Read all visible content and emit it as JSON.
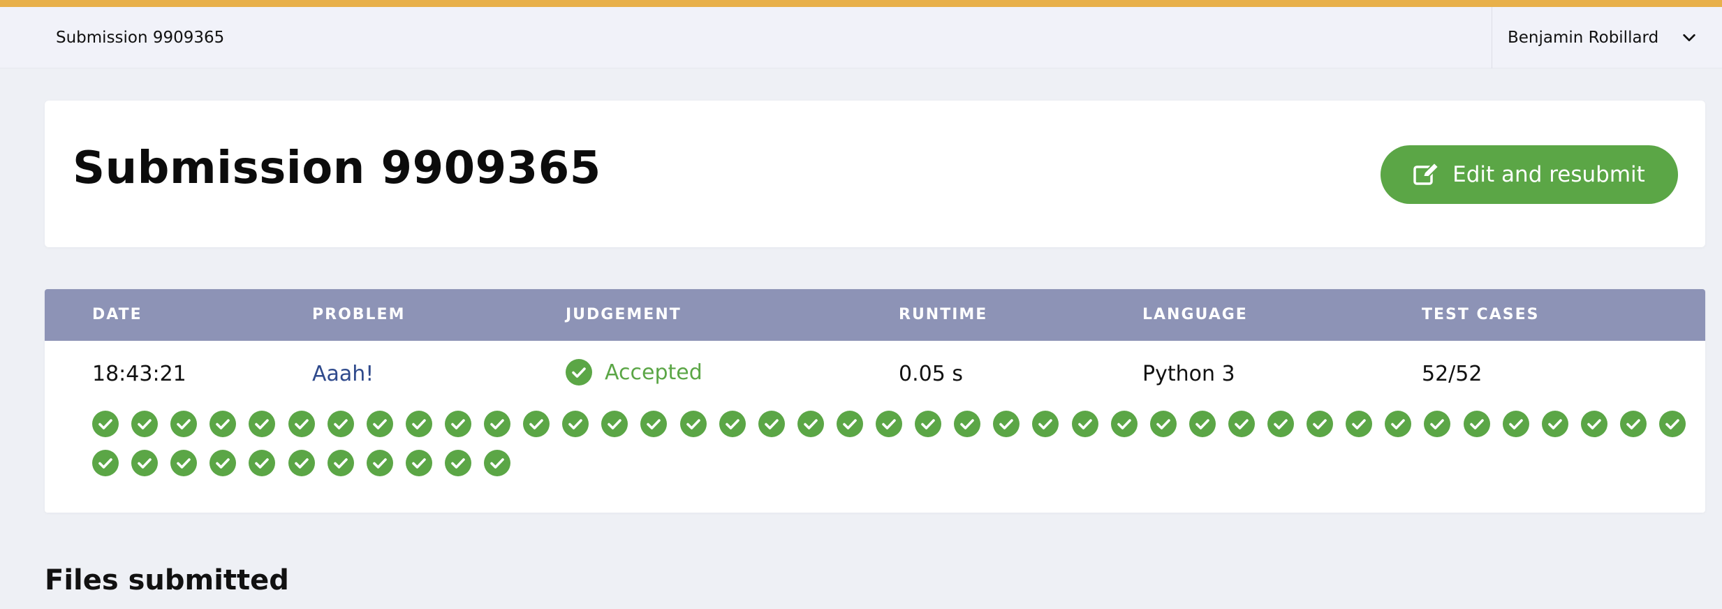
{
  "topbar": {
    "title": "Submission 9909365",
    "user_name": "Benjamin Robillard",
    "chevron_icon": "chevron-down-icon"
  },
  "header": {
    "title": "Submission 9909365",
    "resubmit_label": "Edit and resubmit",
    "resubmit_icon": "edit-icon"
  },
  "table": {
    "columns": [
      "DATE",
      "PROBLEM",
      "JUDGEMENT",
      "RUNTIME",
      "LANGUAGE",
      "TEST CASES"
    ],
    "row": {
      "date": "18:43:21",
      "problem": "Aaah!",
      "judgement": "Accepted",
      "runtime": "0.05 s",
      "language": "Python 3",
      "test_cases": "52/52"
    },
    "test_case_results": {
      "passed": 52,
      "total": 52,
      "icon": "check-circle-icon"
    }
  },
  "files": {
    "heading": "Files submitted"
  },
  "colors": {
    "accent_stripe": "#e8b04a",
    "success": "#5ba646",
    "table_header": "#8d93b6",
    "link": "#2f4a8c"
  }
}
